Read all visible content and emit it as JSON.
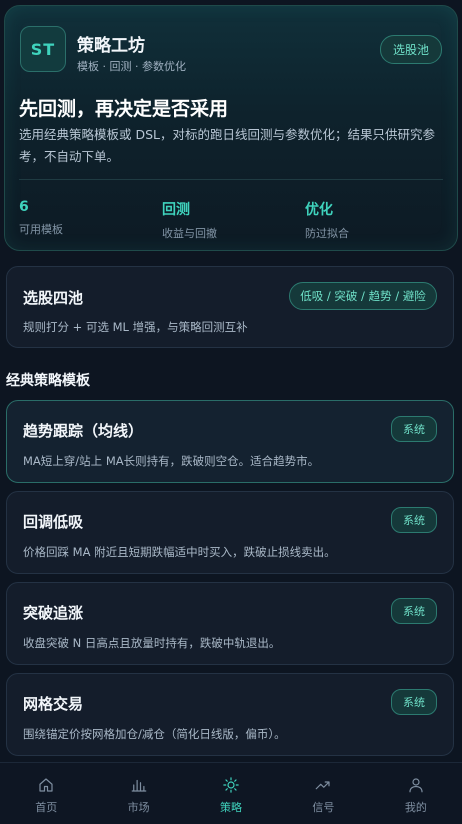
{
  "header": {
    "logo_text": "ST",
    "title": "策略工坊",
    "subtitle": "模板 · 回测 · 参数优化",
    "pill": "选股池"
  },
  "hero": {
    "headline": "先回测，再决定是否采用",
    "description": "选用经典策略模板或 DSL，对标的跑日线回测与参数优化；结果只供研究参考，不自动下单。",
    "stats": [
      {
        "value": "6",
        "label": "可用模板"
      },
      {
        "value": "回测",
        "label": "收益与回撤"
      },
      {
        "value": "优化",
        "label": "防过拟合"
      }
    ]
  },
  "pool_card": {
    "title": "选股四池",
    "tag": "低吸 / 突破 / 趋势 / 避险",
    "description": "规则打分 + 可选 ML 增强，与策略回测互补"
  },
  "section_title": "经典策略模板",
  "templates": [
    {
      "title": "趋势跟踪（均线）",
      "tag": "系统",
      "description": "MA短上穿/站上 MA长则持有，跌破则空仓。适合趋势市。"
    },
    {
      "title": "回调低吸",
      "tag": "系统",
      "description": "价格回踩 MA 附近且短期跌幅适中时买入，跌破止损线卖出。"
    },
    {
      "title": "突破追涨",
      "tag": "系统",
      "description": "收盘突破 N 日高点且放量时持有，跌破中轨退出。"
    },
    {
      "title": "网格交易",
      "tag": "系统",
      "description": "围绕锚定价按网格加仓/减仓（简化日线版，偏币）。"
    }
  ],
  "nav": [
    {
      "label": "首页",
      "icon": "home-icon"
    },
    {
      "label": "市场",
      "icon": "bar-chart-icon"
    },
    {
      "label": "策略",
      "icon": "sun-icon",
      "active": true
    },
    {
      "label": "信号",
      "icon": "trend-up-icon"
    },
    {
      "label": "我的",
      "icon": "user-icon"
    }
  ],
  "colors": {
    "accent": "#3fd3bd",
    "background": "#0d1521",
    "card": "#141d2b"
  }
}
